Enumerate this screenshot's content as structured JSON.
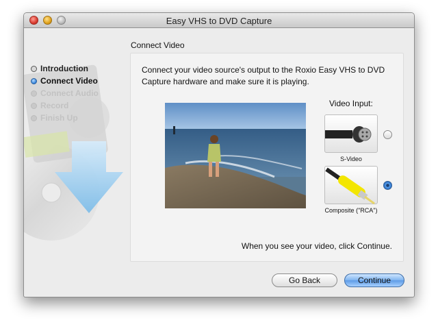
{
  "window": {
    "title": "Easy VHS to DVD Capture"
  },
  "sidebar": {
    "steps": [
      {
        "label": "Introduction",
        "state": "done"
      },
      {
        "label": "Connect Video",
        "state": "current"
      },
      {
        "label": "Connect Audio",
        "state": "pending"
      },
      {
        "label": "Record",
        "state": "pending"
      },
      {
        "label": "Finish Up",
        "state": "pending"
      }
    ]
  },
  "panel": {
    "heading": "Connect Video",
    "instructions": "Connect your video source's output to the Roxio Easy VHS to DVD Capture hardware and make sure it is playing.",
    "video_input_label": "Video Input:",
    "inputs": [
      {
        "label": "S-Video",
        "selected": false
      },
      {
        "label": "Composite (\"RCA\")",
        "selected": true
      }
    ],
    "continue_hint": "When you see your video, click Continue."
  },
  "buttons": {
    "back": "Go Back",
    "continue": "Continue"
  },
  "colors": {
    "accent": "#5e9be6",
    "window_bg": "#ececec"
  }
}
